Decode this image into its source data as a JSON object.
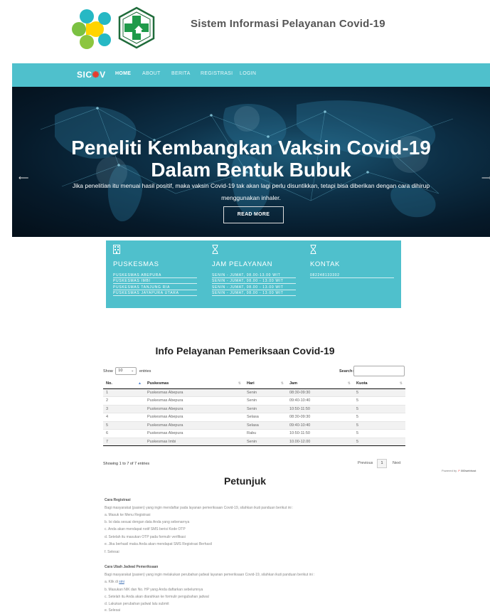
{
  "header": {
    "site_title": "Sistem Informasi Pelayanan Covid-19"
  },
  "navbar": {
    "brand_prefix": "SIC",
    "brand_suffix": "V",
    "items": [
      {
        "label": "HOME",
        "active": true
      },
      {
        "label": "ABOUT",
        "active": false
      },
      {
        "label": "BERITA",
        "active": false
      },
      {
        "label": "REGISTRASI",
        "active": false
      },
      {
        "label": "LOGIN",
        "active": false
      }
    ]
  },
  "hero": {
    "title_line1": "Peneliti Kembangkan Vaksin Covid-19",
    "title_line2": "Dalam Bentuk Bubuk",
    "subtitle_line1": "Jika penelitian itu menuai hasil positif, maka vaksin Covid-19 tak akan lagi perlu disuntikkan, tetapi bisa diberikan dengan cara dihirup",
    "subtitle_line2": "menggunakan inhaler.",
    "button_label": "READ MORE",
    "prev_arrow": "⟵",
    "next_arrow": "⟶"
  },
  "info": {
    "puskesmas": {
      "heading": "PUSKESMAS",
      "items": [
        "PUSKESMAS ABEPURA",
        "PUSKESMAS IMBI",
        "PUSKESMAS TANJUNG RIA",
        "PUSKESMAS JAYAPURA UTARA"
      ]
    },
    "jam": {
      "heading": "JAM PELAYANAN",
      "items": [
        "SENIN - JUMAT, 08.00-13.00 WIT",
        "SENIN - JUMAT, 08.00 - 13.00 WIT",
        "SENIN - JUMAT, 08.00 - 13.00 WIT",
        "SENIN - JUMAT, 08.00 - 13.00 WIT"
      ]
    },
    "kontak": {
      "heading": "KONTAK",
      "items": [
        "082248133302"
      ]
    }
  },
  "table_section": {
    "title": "Info Pelayanan Pemeriksaan Covid-19",
    "show_label": "Show",
    "entries_value": "10",
    "entries_label": "entries",
    "search_label": "Search:",
    "search_value": "",
    "columns": [
      "No.",
      "Puskesmas",
      "Hari",
      "Jam",
      "Kuota"
    ],
    "rows": [
      [
        "1",
        "Puskesmas Abepura",
        "Senin",
        "08:30-09:30",
        "5"
      ],
      [
        "2",
        "Puskesmas Abepura",
        "Senin",
        "09:40-10:40",
        "5"
      ],
      [
        "3",
        "Puskesmas Abepura",
        "Senin",
        "10:50-11:50",
        "5"
      ],
      [
        "4",
        "Puskesmas Abepura",
        "Selasa",
        "08:30-09:30",
        "5"
      ],
      [
        "5",
        "Puskesmas Abepura",
        "Selasa",
        "09:40-10:40",
        "5"
      ],
      [
        "6",
        "Puskesmas Abepura",
        "Rabu",
        "10:50-11:50",
        "5"
      ],
      [
        "7",
        "Puskesmas Imbi",
        "Senin",
        "10.00-12.00",
        "5"
      ]
    ],
    "showing_text": "Showing 1 to 7 of 7 entries",
    "previous_label": "Previous",
    "page_label": "1",
    "next_label": "Next"
  },
  "powered": {
    "prefix": "Powered by",
    "brand": "000webhost"
  },
  "petunjuk": {
    "title": "Petunjuk",
    "registrasi_heading": "Cara Registrasi",
    "registrasi_lines": [
      "Bagi masyarakat (pasien) yang ingin mendaftar pada layanan pemeriksaan Covid-19, silahkan ikuti panduan berikut ini :",
      "a. Masuk ke Menu Registrasi",
      "b. Isi data sesuai dengan data Anda yang sebenarnya",
      "c. Anda akan mendapat notif SMS berisi Kode OTP",
      "d. Setelah itu masukan OTP pada formulir verifikasi",
      "e. Jika berhasil maka Anda akan mendapat SMS Registrasi Berhasil",
      "f. Selesai"
    ],
    "jadwal_heading": "Cara Ubah Jadwal Pemeriksaan",
    "jadwal_lines": [
      "Bagi masyarakat (pasien) yang ingin melakukan perubahan jadwal layanan pemeriksaan Covid-19, silahkan ikuti panduan berikut ini :",
      "b. Masukan NIK dan No. HP yang Anda daftarkan sebelumnya",
      "c. Setelah itu Anda akan diarahkan ke formulir pengubahan jadwal",
      "d. Lakukan perubahan jadwal lalu submit",
      "e. Selesai"
    ],
    "jadwal_a_prefix": "a. Klik di",
    "jadwal_a_link": "sini"
  }
}
